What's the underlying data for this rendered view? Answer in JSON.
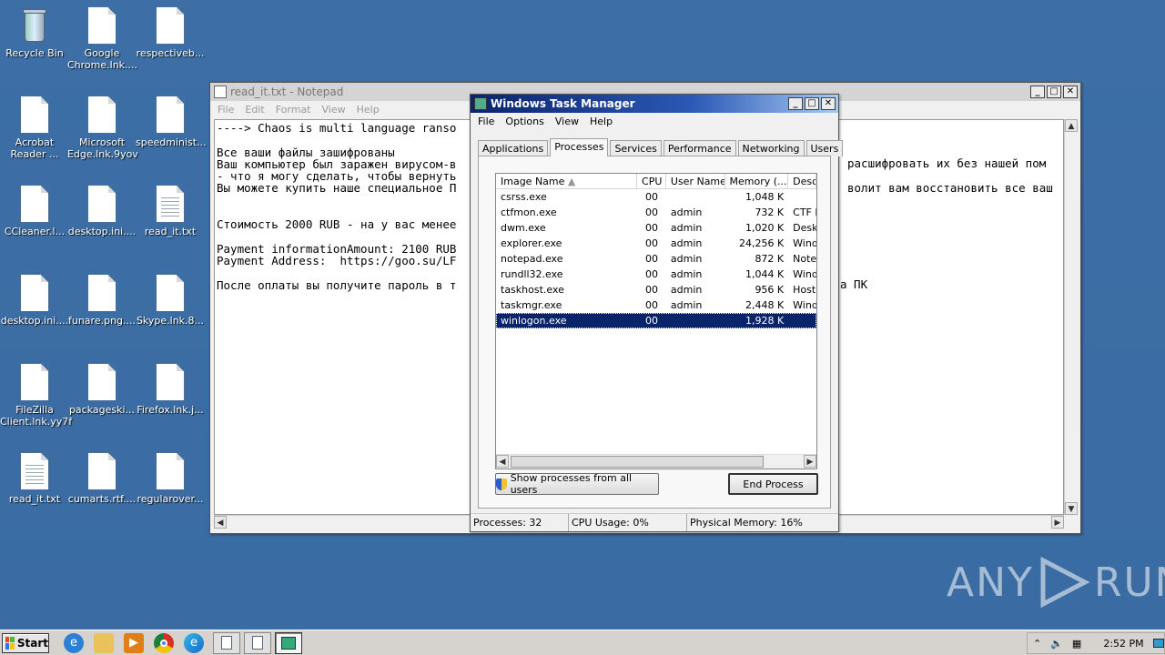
{
  "desktop": {
    "icons": [
      {
        "label": "Recycle Bin",
        "type": "bin"
      },
      {
        "label": "Google Chrome.lnk....",
        "type": "file"
      },
      {
        "label": "respectiveb...",
        "type": "file"
      },
      {
        "label": "Acrobat Reader ...",
        "type": "file"
      },
      {
        "label": "Microsoft Edge.lnk.9yov",
        "type": "file"
      },
      {
        "label": "speedminist...",
        "type": "file"
      },
      {
        "label": "CCleaner.l...",
        "type": "file"
      },
      {
        "label": "desktop.ini....",
        "type": "file"
      },
      {
        "label": "read_it.txt",
        "type": "txt"
      },
      {
        "label": "desktop.ini....",
        "type": "file"
      },
      {
        "label": "funare.png....",
        "type": "file"
      },
      {
        "label": "Skype.lnk.8...",
        "type": "file"
      },
      {
        "label": "FileZilla Client.lnk.yy7f",
        "type": "file"
      },
      {
        "label": "packageski...",
        "type": "file"
      },
      {
        "label": "Firefox.lnk.j...",
        "type": "file"
      },
      {
        "label": "read_it.txt",
        "type": "txt"
      },
      {
        "label": "cumarts.rtf....",
        "type": "file"
      },
      {
        "label": "regularover...",
        "type": "file"
      }
    ]
  },
  "notepad": {
    "title": "read_it.txt - Notepad",
    "menu": [
      "File",
      "Edit",
      "Format",
      "View",
      "Help"
    ],
    "lines": [
      "----> Chaos is multi language ranso",
      "",
      "Все ваши файлы зашифрованы",
      "Ваш компьютер был заражен вирусом-в",
      "- что я могу сделать, чтобы вернуть",
      "Вы можете купить наше специальное П",
      "",
      "",
      "Стоимость 2000 RUB - на у вас менее",
      "",
      "Payment informationAmount: 2100 RUB",
      "Payment Address:  https://goo.su/LF",
      "",
      "После оплаты вы получите пароль в т"
    ],
    "right_lines": [
      {
        "row": 3,
        "text": "расшифровать их без нашей пом"
      },
      {
        "row": 5,
        "text": "волит вам восстановить все ваш"
      },
      {
        "row": 13,
        "text": "а ПК"
      }
    ]
  },
  "taskmgr": {
    "title": "Windows Task Manager",
    "menu": [
      "File",
      "Options",
      "View",
      "Help"
    ],
    "tabs": [
      "Applications",
      "Processes",
      "Services",
      "Performance",
      "Networking",
      "Users"
    ],
    "selected_tab": "Processes",
    "columns": [
      "Image Name",
      "CPU",
      "User Name",
      "Memory (...",
      "Desc"
    ],
    "rows": [
      {
        "name": "csrss.exe",
        "cpu": "00",
        "user": "",
        "mem": "1,048 K",
        "desc": ""
      },
      {
        "name": "ctfmon.exe",
        "cpu": "00",
        "user": "admin",
        "mem": "732 K",
        "desc": "CTF I"
      },
      {
        "name": "dwm.exe",
        "cpu": "00",
        "user": "admin",
        "mem": "1,020 K",
        "desc": "Desk"
      },
      {
        "name": "explorer.exe",
        "cpu": "00",
        "user": "admin",
        "mem": "24,256 K",
        "desc": "Wind"
      },
      {
        "name": "notepad.exe",
        "cpu": "00",
        "user": "admin",
        "mem": "872 K",
        "desc": "Note"
      },
      {
        "name": "rundll32.exe",
        "cpu": "00",
        "user": "admin",
        "mem": "1,044 K",
        "desc": "Wind"
      },
      {
        "name": "taskhost.exe",
        "cpu": "00",
        "user": "admin",
        "mem": "956 K",
        "desc": "Host"
      },
      {
        "name": "taskmgr.exe",
        "cpu": "00",
        "user": "admin",
        "mem": "2,448 K",
        "desc": "Wind"
      },
      {
        "name": "winlogon.exe",
        "cpu": "00",
        "user": "",
        "mem": "1,928 K",
        "desc": ""
      }
    ],
    "selected_row": 8,
    "show_all_label": "Show processes from all users",
    "end_process_label": "End Process",
    "status": {
      "processes": "Processes: 32",
      "cpu": "CPU Usage: 0%",
      "memory": "Physical Memory: 16%"
    }
  },
  "taskbar": {
    "start_label": "Start",
    "clock": "2:52 PM"
  },
  "watermark": {
    "left": "ANY",
    "right": "RUN"
  }
}
